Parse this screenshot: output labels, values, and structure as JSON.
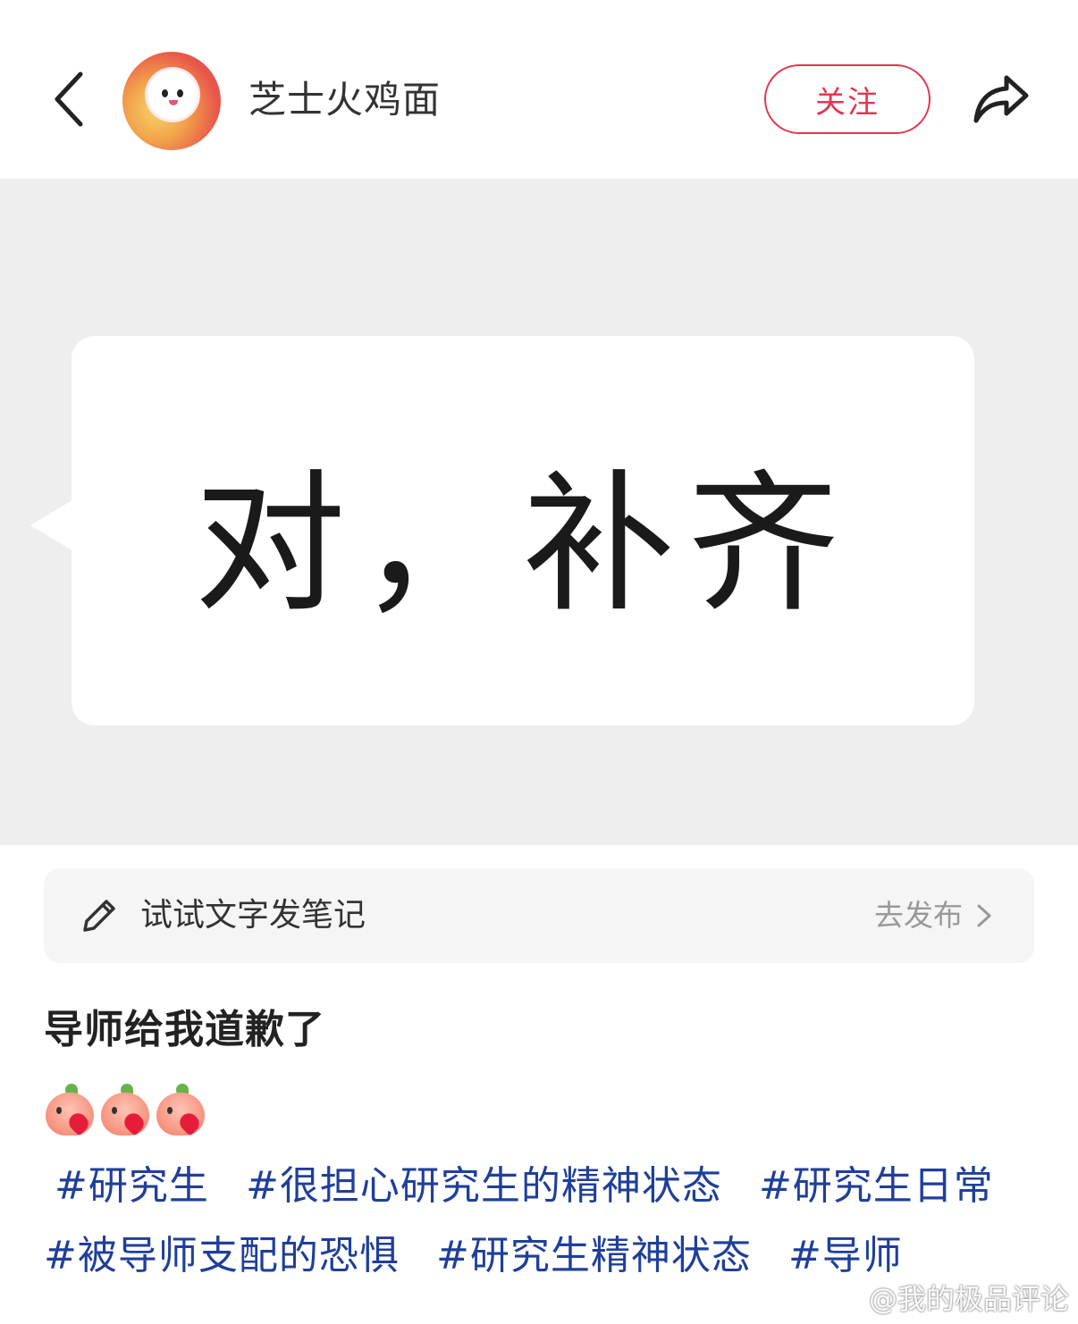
{
  "header": {
    "username": "芝士火鸡面",
    "follow_label": "关注"
  },
  "image": {
    "bubble_text": "对，补齐"
  },
  "note_bar": {
    "label": "试试文字发笔记",
    "action": "去发布"
  },
  "post": {
    "title": "导师给我道歉了",
    "emoji_count": 3,
    "tags_line1": [
      "#研究生",
      "#很担心研究生的精神状态",
      "#研究生日常"
    ],
    "tags_line2": [
      "#被导师支配的恐惧",
      "#研究生精神状态",
      "#导师"
    ]
  },
  "watermark": "@我的极品评论",
  "colors": {
    "accent": "#e0384f",
    "tag": "#1f3f9a",
    "image_bg": "#eeeeee"
  }
}
